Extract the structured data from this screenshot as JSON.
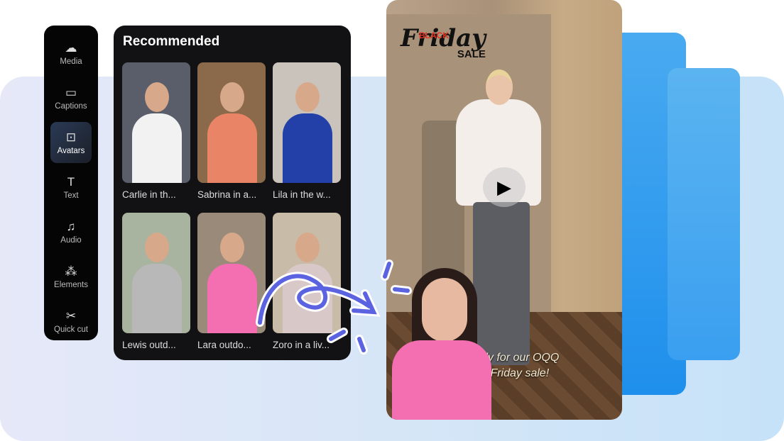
{
  "sidebar": {
    "items": [
      {
        "label": "Media",
        "icon": "cloud-upload-icon",
        "glyph": "☁"
      },
      {
        "label": "Captions",
        "icon": "captions-icon",
        "glyph": "▭"
      },
      {
        "label": "Avatars",
        "icon": "avatar-icon",
        "glyph": "⊡",
        "active": true
      },
      {
        "label": "Text",
        "icon": "text-icon",
        "glyph": "T"
      },
      {
        "label": "Audio",
        "icon": "music-note-icon",
        "glyph": "♫"
      },
      {
        "label": "Elements",
        "icon": "elements-icon",
        "glyph": "⁂"
      },
      {
        "label": "Quick cut",
        "icon": "scissors-icon",
        "glyph": "✂"
      }
    ]
  },
  "recommended": {
    "title": "Recommended",
    "avatars": [
      {
        "label": "Carlie in th...",
        "shirt": "#f2f2f2",
        "bg": "#5a5e6a"
      },
      {
        "label": "Sabrina in a...",
        "shirt": "#e98466",
        "bg": "#8a6a4a"
      },
      {
        "label": "Lila in the w...",
        "shirt": "#2340a8",
        "bg": "#c9c3bc"
      },
      {
        "label": "Lewis outd...",
        "shirt": "#b8b8b8",
        "bg": "#a8b4a0"
      },
      {
        "label": "Lara outdo...",
        "shirt": "#f46fb1",
        "bg": "#9a8a7a"
      },
      {
        "label": "Zoro in a liv...",
        "shirt": "#d8c8c8",
        "bg": "#c8bca8"
      }
    ]
  },
  "video": {
    "logo": {
      "black": "BLACK",
      "friday": "Friday",
      "sale": "SALE"
    },
    "caption_line1": "dy for our OQQ",
    "caption_line2": "k Friday sale!",
    "play_icon": "play-icon"
  },
  "colors": {
    "accent": "#5b63e0",
    "card_blue": "#1e8fec"
  }
}
